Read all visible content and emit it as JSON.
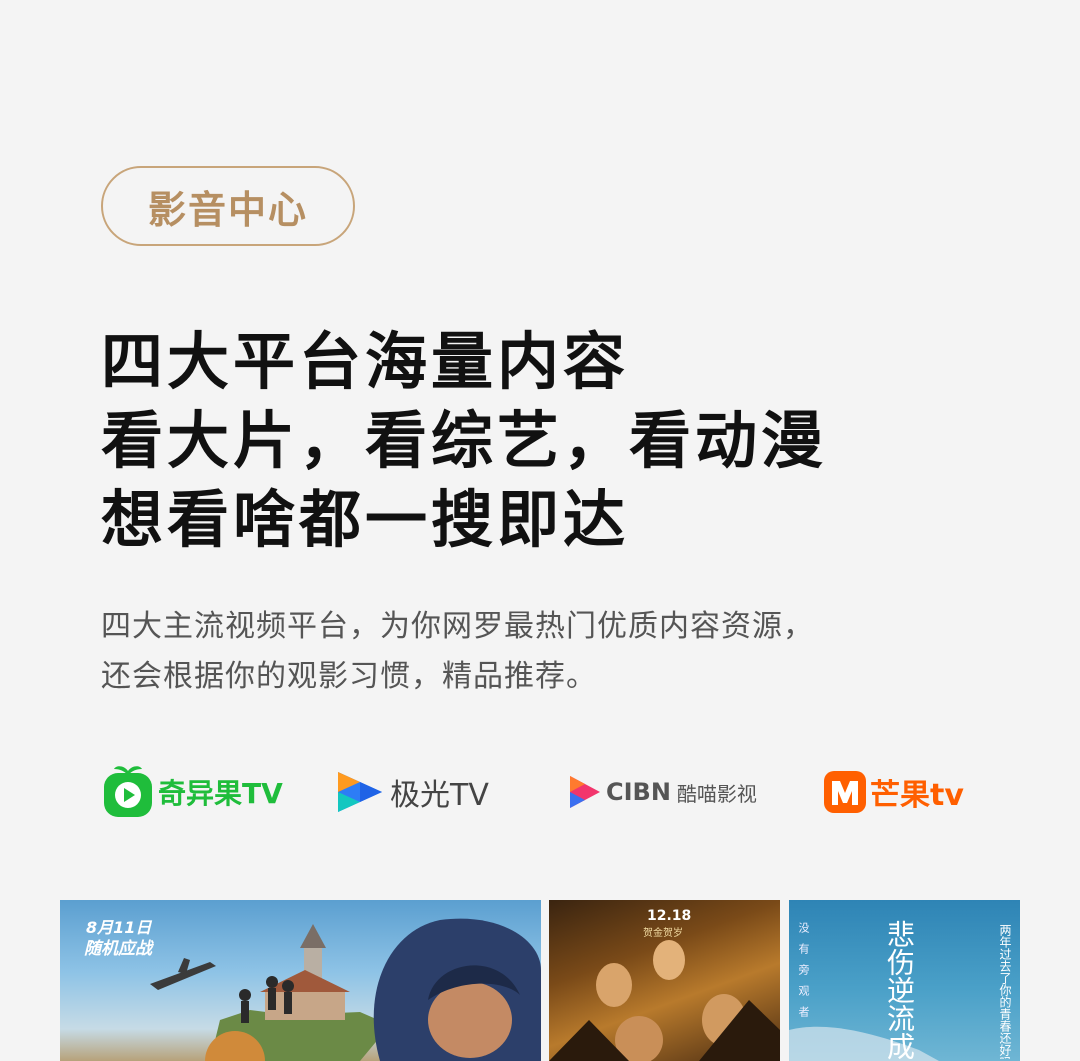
{
  "badge": {
    "label": "影音中心"
  },
  "headline": {
    "lines": [
      "四大平台海量内容",
      "看大片，看综艺，看动漫",
      "想看啥都一搜即达"
    ]
  },
  "description": {
    "lines": [
      "四大主流视频平台，为你网罗最热门优质内容资源，",
      "还会根据你的观影习惯，精品推荐。"
    ]
  },
  "platforms": [
    {
      "name": "奇异果TV",
      "icon": "kiwi-play-icon",
      "color": "#1fbd3b"
    },
    {
      "name": "极光TV",
      "icon": "aurora-play-icon",
      "color": "#2d7df6"
    },
    {
      "name": "CIBN",
      "subname": "酷喵影视",
      "icon": "cibn-play-icon",
      "color": "#555555"
    },
    {
      "name": "芒果tv",
      "icon": "mango-m-icon",
      "color": "#ff5f00"
    }
  ],
  "posters": [
    {
      "date_text": "8月11日",
      "caption": "随机应战"
    },
    {
      "date_text": "12.18",
      "caption": "贺金贺岁"
    },
    {
      "title": "悲伤逆流成河",
      "side_text": "没有旁观者",
      "tagline": "两年过去了你的青春还好吗"
    }
  ],
  "colors": {
    "badge_border": "#c8a57a",
    "badge_text": "#b68f62",
    "headline": "#111111",
    "description": "#555555",
    "background": "#f4f4f4"
  }
}
